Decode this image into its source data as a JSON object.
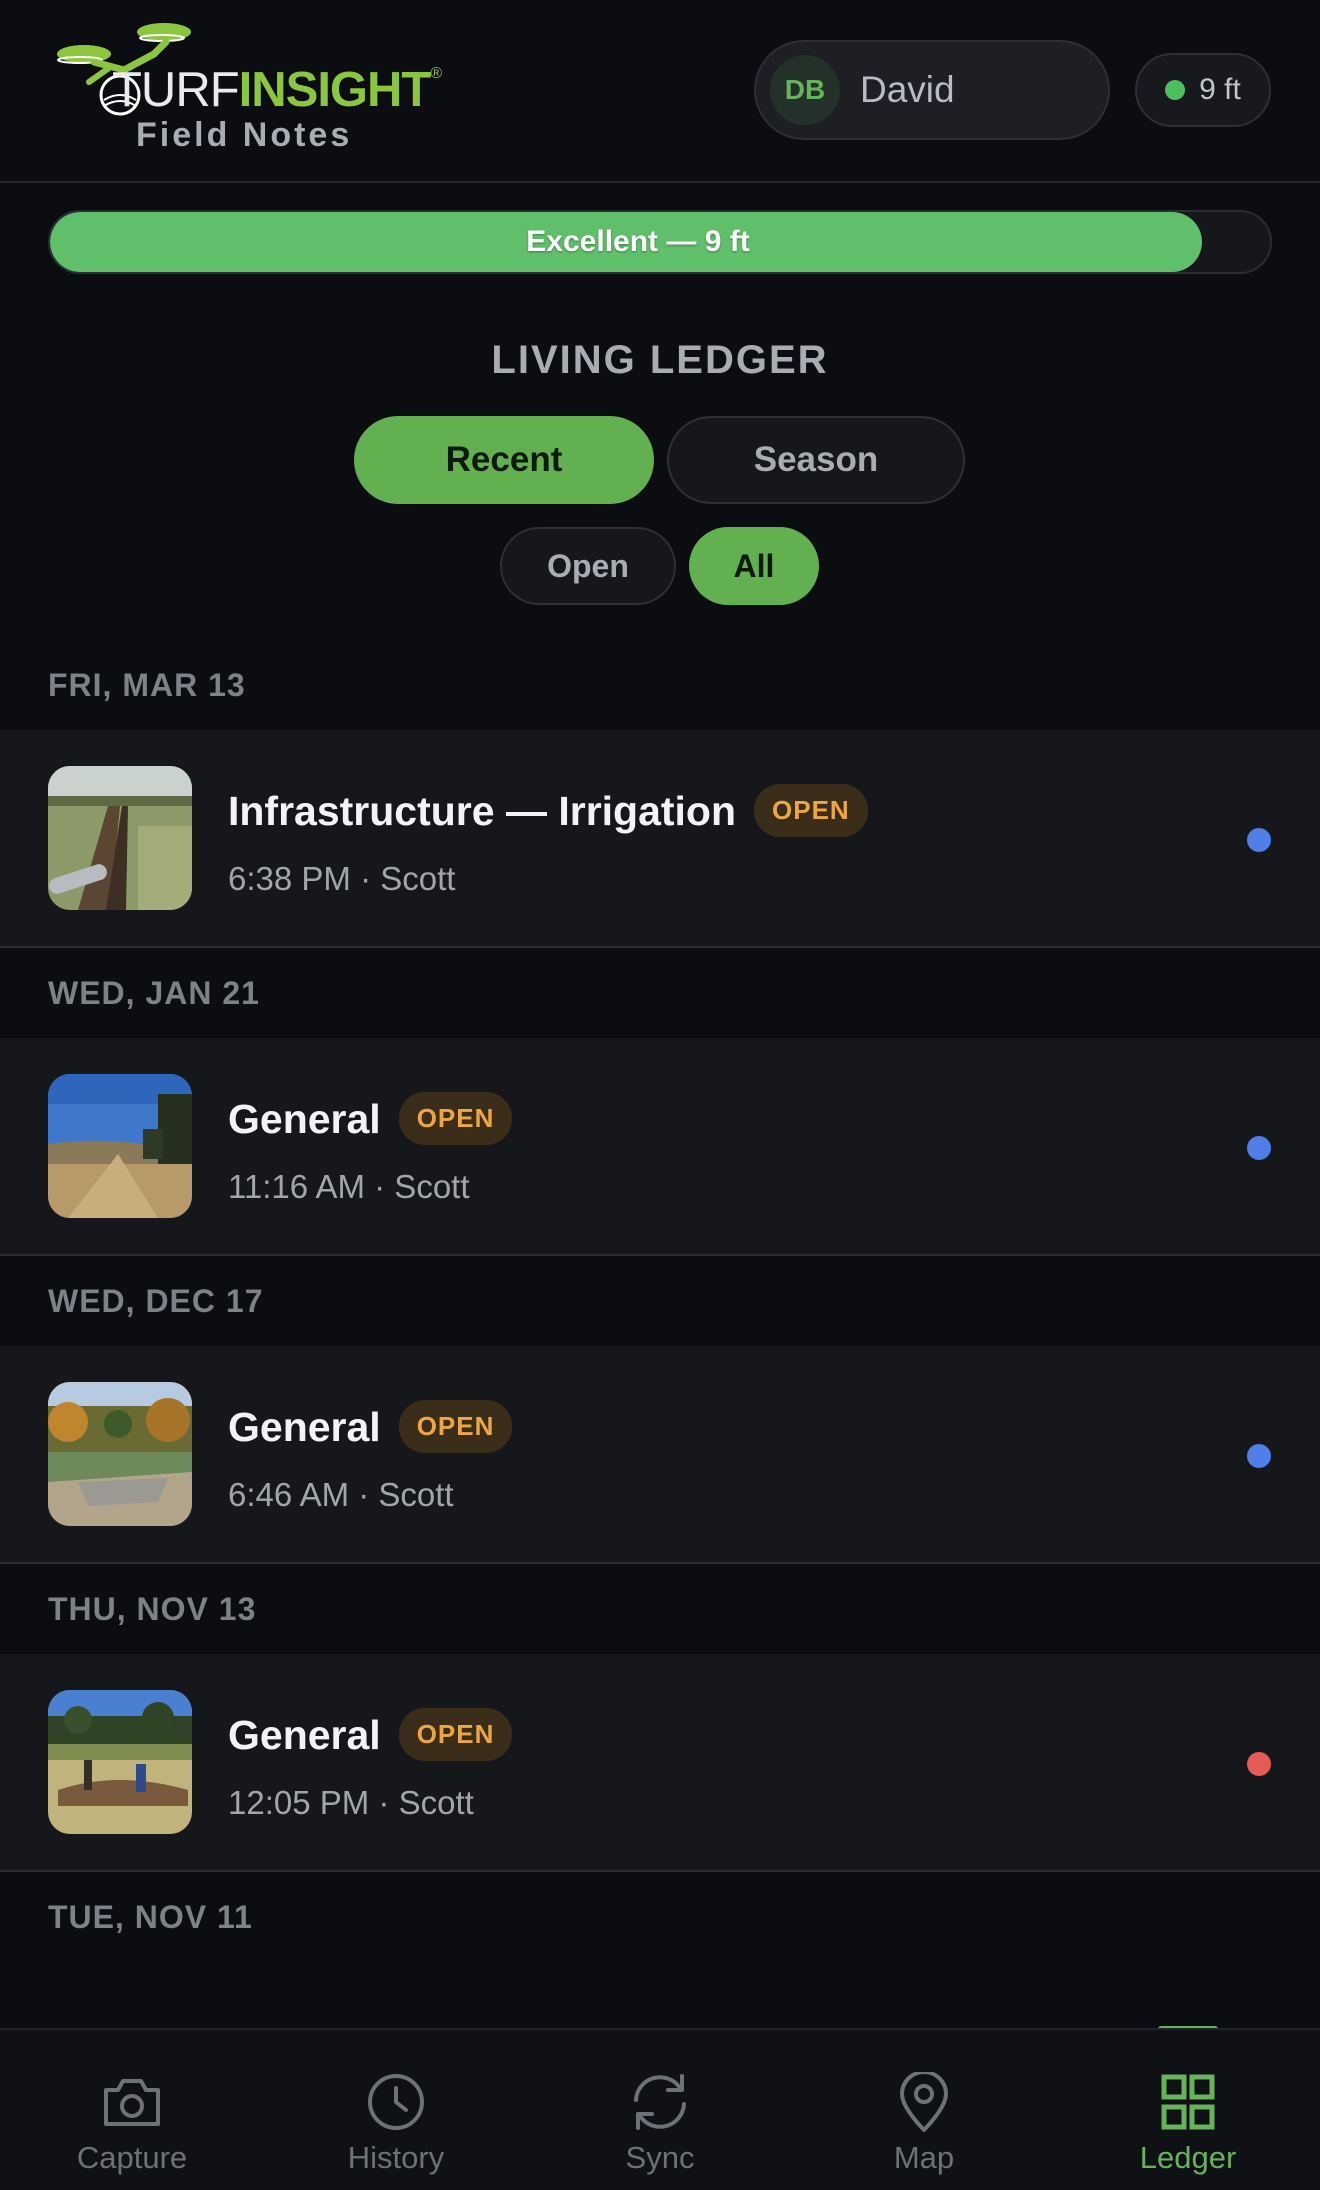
{
  "header": {
    "logo": {
      "word_light": "TURF",
      "word_bold": "INSIGHT",
      "trademark": "®",
      "subtitle": "Field Notes"
    },
    "user": {
      "initials": "DB",
      "name": "David"
    },
    "gps": {
      "status_color": "#4cc05d",
      "label": "9 ft"
    }
  },
  "accuracy": {
    "label": "Excellent — 9 ft",
    "fill_fraction": 0.944,
    "color": "#5fbf6a"
  },
  "ledger": {
    "title": "LIVING LEDGER",
    "view_tabs": {
      "recent": "Recent",
      "season": "Season",
      "selected": "recent"
    },
    "filter_tabs": {
      "open": "Open",
      "all": "All",
      "selected": "all"
    },
    "groups": [
      {
        "date": "FRI, MAR 13",
        "entry": {
          "title": "Infrastructure — Irrigation",
          "badge": "OPEN",
          "meta": "6:38 PM · Scott",
          "dot_color": "#4f7ee8",
          "thumb": "irrigation-trench-photo"
        }
      },
      {
        "date": "WED, JAN 21",
        "entry": {
          "title": "General",
          "badge": "OPEN",
          "meta": "11:16 AM · Scott",
          "dot_color": "#4f7ee8",
          "thumb": "fairway-sky-photo"
        }
      },
      {
        "date": "WED, DEC 17",
        "entry": {
          "title": "General",
          "badge": "OPEN",
          "meta": "6:46 AM · Scott",
          "dot_color": "#4f7ee8",
          "thumb": "autumn-trees-photo"
        }
      },
      {
        "date": "THU, NOV 13",
        "entry": {
          "title": "General",
          "badge": "OPEN",
          "meta": "12:05 PM · Scott",
          "dot_color": "#e55a55",
          "thumb": "crew-on-green-photo"
        }
      },
      {
        "date": "TUE, NOV 11"
      }
    ]
  },
  "nav": {
    "items": [
      {
        "label": "Capture",
        "icon": "camera-icon"
      },
      {
        "label": "History",
        "icon": "clock-icon"
      },
      {
        "label": "Sync",
        "icon": "sync-icon"
      },
      {
        "label": "Map",
        "icon": "map-pin-icon"
      },
      {
        "label": "Ledger",
        "icon": "grid-icon"
      }
    ],
    "active": "Ledger",
    "accent": "#66b35b",
    "inactive_color": "#6d7178"
  }
}
